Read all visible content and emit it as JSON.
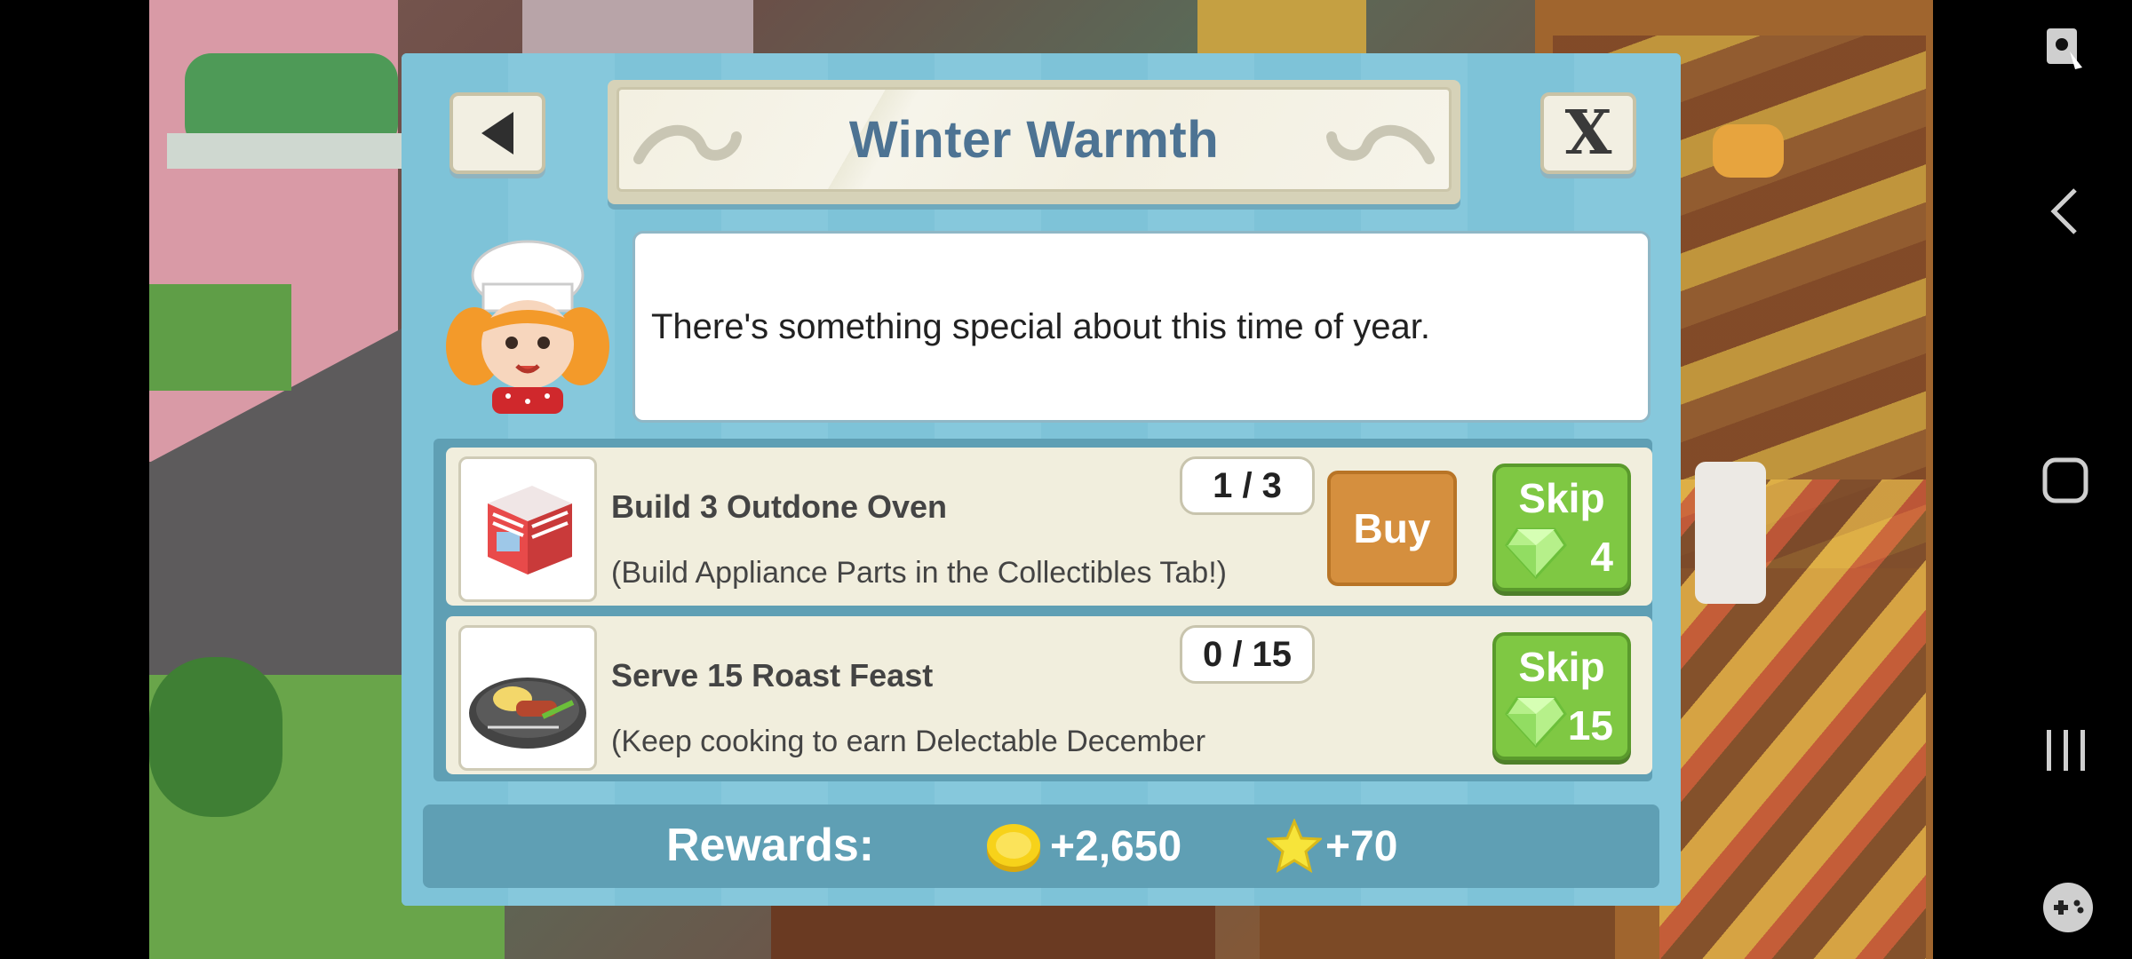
{
  "dialog": {
    "title": "Winter Warmth",
    "close_label": "X",
    "speech": "There's something special about this time of year."
  },
  "tasks": [
    {
      "title": "Build 3 Outdone Oven",
      "description": "(Build Appliance Parts in the Collectibles Tab!)",
      "progress": "1 / 3",
      "buy_label": "Buy",
      "skip_label": "Skip",
      "skip_cost": "4"
    },
    {
      "title": "Serve 15 Roast Feast",
      "description": "(Keep cooking to earn Delectable December",
      "progress": "0 / 15",
      "skip_label": "Skip",
      "skip_cost": "15"
    }
  ],
  "rewards": {
    "label": "Rewards:",
    "coins": "+2,650",
    "stars": "+70"
  },
  "icons": {
    "back": "left-arrow-icon",
    "gem": "gem-icon",
    "coin": "coin-icon",
    "star": "star-icon"
  },
  "colors": {
    "title": "#4d7393",
    "panel": "#7cc0d6",
    "buy": "#d58f3e",
    "skip": "#7fc843"
  }
}
